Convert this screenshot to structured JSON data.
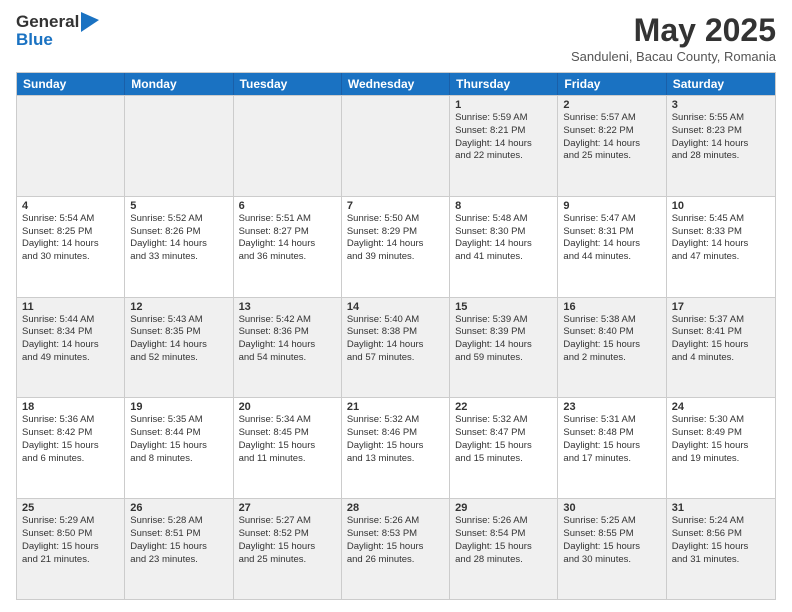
{
  "header": {
    "logo_line1": "General",
    "logo_line2": "Blue",
    "month": "May 2025",
    "location": "Sanduleni, Bacau County, Romania"
  },
  "days_of_week": [
    "Sunday",
    "Monday",
    "Tuesday",
    "Wednesday",
    "Thursday",
    "Friday",
    "Saturday"
  ],
  "rows": [
    [
      {
        "day": "",
        "text": ""
      },
      {
        "day": "",
        "text": ""
      },
      {
        "day": "",
        "text": ""
      },
      {
        "day": "",
        "text": ""
      },
      {
        "day": "1",
        "text": "Sunrise: 5:59 AM\nSunset: 8:21 PM\nDaylight: 14 hours\nand 22 minutes."
      },
      {
        "day": "2",
        "text": "Sunrise: 5:57 AM\nSunset: 8:22 PM\nDaylight: 14 hours\nand 25 minutes."
      },
      {
        "day": "3",
        "text": "Sunrise: 5:55 AM\nSunset: 8:23 PM\nDaylight: 14 hours\nand 28 minutes."
      }
    ],
    [
      {
        "day": "4",
        "text": "Sunrise: 5:54 AM\nSunset: 8:25 PM\nDaylight: 14 hours\nand 30 minutes."
      },
      {
        "day": "5",
        "text": "Sunrise: 5:52 AM\nSunset: 8:26 PM\nDaylight: 14 hours\nand 33 minutes."
      },
      {
        "day": "6",
        "text": "Sunrise: 5:51 AM\nSunset: 8:27 PM\nDaylight: 14 hours\nand 36 minutes."
      },
      {
        "day": "7",
        "text": "Sunrise: 5:50 AM\nSunset: 8:29 PM\nDaylight: 14 hours\nand 39 minutes."
      },
      {
        "day": "8",
        "text": "Sunrise: 5:48 AM\nSunset: 8:30 PM\nDaylight: 14 hours\nand 41 minutes."
      },
      {
        "day": "9",
        "text": "Sunrise: 5:47 AM\nSunset: 8:31 PM\nDaylight: 14 hours\nand 44 minutes."
      },
      {
        "day": "10",
        "text": "Sunrise: 5:45 AM\nSunset: 8:33 PM\nDaylight: 14 hours\nand 47 minutes."
      }
    ],
    [
      {
        "day": "11",
        "text": "Sunrise: 5:44 AM\nSunset: 8:34 PM\nDaylight: 14 hours\nand 49 minutes."
      },
      {
        "day": "12",
        "text": "Sunrise: 5:43 AM\nSunset: 8:35 PM\nDaylight: 14 hours\nand 52 minutes."
      },
      {
        "day": "13",
        "text": "Sunrise: 5:42 AM\nSunset: 8:36 PM\nDaylight: 14 hours\nand 54 minutes."
      },
      {
        "day": "14",
        "text": "Sunrise: 5:40 AM\nSunset: 8:38 PM\nDaylight: 14 hours\nand 57 minutes."
      },
      {
        "day": "15",
        "text": "Sunrise: 5:39 AM\nSunset: 8:39 PM\nDaylight: 14 hours\nand 59 minutes."
      },
      {
        "day": "16",
        "text": "Sunrise: 5:38 AM\nSunset: 8:40 PM\nDaylight: 15 hours\nand 2 minutes."
      },
      {
        "day": "17",
        "text": "Sunrise: 5:37 AM\nSunset: 8:41 PM\nDaylight: 15 hours\nand 4 minutes."
      }
    ],
    [
      {
        "day": "18",
        "text": "Sunrise: 5:36 AM\nSunset: 8:42 PM\nDaylight: 15 hours\nand 6 minutes."
      },
      {
        "day": "19",
        "text": "Sunrise: 5:35 AM\nSunset: 8:44 PM\nDaylight: 15 hours\nand 8 minutes."
      },
      {
        "day": "20",
        "text": "Sunrise: 5:34 AM\nSunset: 8:45 PM\nDaylight: 15 hours\nand 11 minutes."
      },
      {
        "day": "21",
        "text": "Sunrise: 5:32 AM\nSunset: 8:46 PM\nDaylight: 15 hours\nand 13 minutes."
      },
      {
        "day": "22",
        "text": "Sunrise: 5:32 AM\nSunset: 8:47 PM\nDaylight: 15 hours\nand 15 minutes."
      },
      {
        "day": "23",
        "text": "Sunrise: 5:31 AM\nSunset: 8:48 PM\nDaylight: 15 hours\nand 17 minutes."
      },
      {
        "day": "24",
        "text": "Sunrise: 5:30 AM\nSunset: 8:49 PM\nDaylight: 15 hours\nand 19 minutes."
      }
    ],
    [
      {
        "day": "25",
        "text": "Sunrise: 5:29 AM\nSunset: 8:50 PM\nDaylight: 15 hours\nand 21 minutes."
      },
      {
        "day": "26",
        "text": "Sunrise: 5:28 AM\nSunset: 8:51 PM\nDaylight: 15 hours\nand 23 minutes."
      },
      {
        "day": "27",
        "text": "Sunrise: 5:27 AM\nSunset: 8:52 PM\nDaylight: 15 hours\nand 25 minutes."
      },
      {
        "day": "28",
        "text": "Sunrise: 5:26 AM\nSunset: 8:53 PM\nDaylight: 15 hours\nand 26 minutes."
      },
      {
        "day": "29",
        "text": "Sunrise: 5:26 AM\nSunset: 8:54 PM\nDaylight: 15 hours\nand 28 minutes."
      },
      {
        "day": "30",
        "text": "Sunrise: 5:25 AM\nSunset: 8:55 PM\nDaylight: 15 hours\nand 30 minutes."
      },
      {
        "day": "31",
        "text": "Sunrise: 5:24 AM\nSunset: 8:56 PM\nDaylight: 15 hours\nand 31 minutes."
      }
    ]
  ]
}
